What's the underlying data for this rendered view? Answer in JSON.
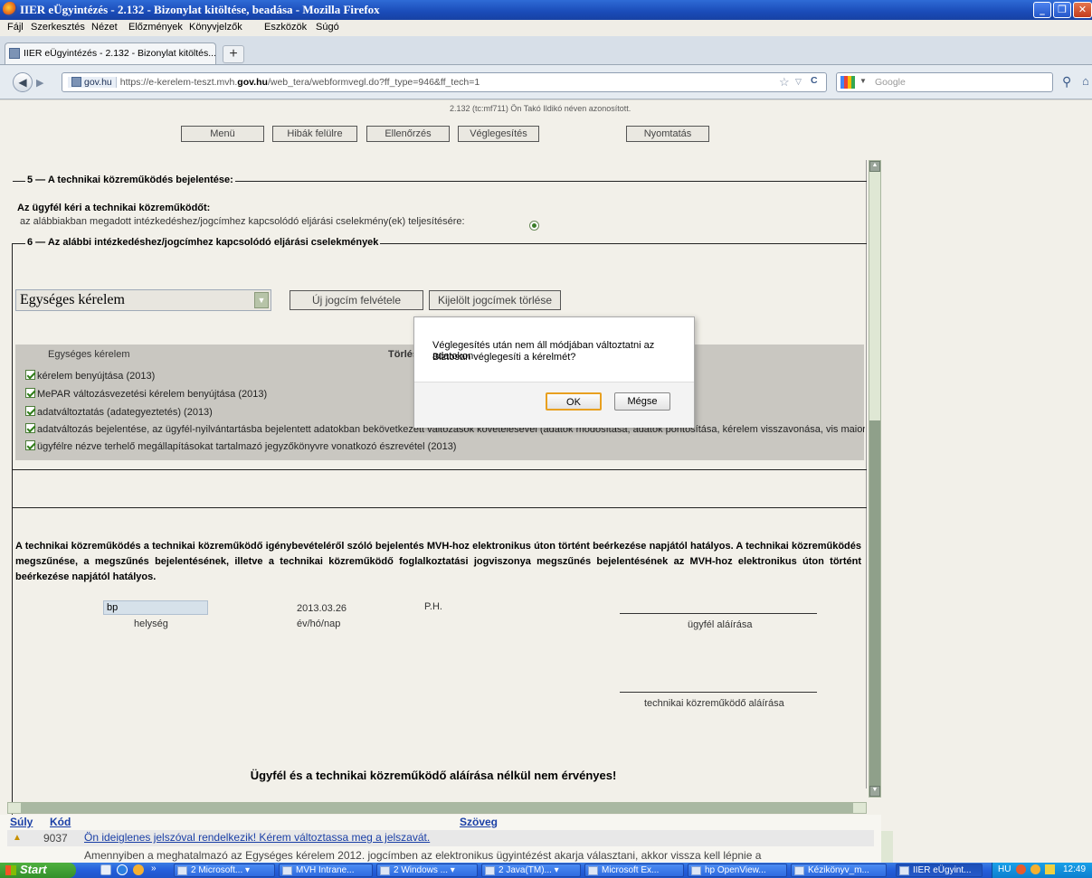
{
  "window": {
    "title": "IIER eÜgyintézés - 2.132 - Bizonylat kitöltése, beadása - Mozilla Firefox",
    "minimize": "_",
    "restore": "❐",
    "close": "✕"
  },
  "menu": [
    "Fájl",
    "Szerkesztés",
    "Nézet",
    "Előzmények",
    "Könyvjelzők",
    "Eszközök",
    "Súgó"
  ],
  "tab": {
    "label": "IIER eÜgyintézés - 2.132 - Bizonylat kitöltés...",
    "new": "+"
  },
  "nav": {
    "site": "gov.hu",
    "url_prefix": "https://e-kerelem-teszt.mvh.",
    "url_domain": "gov.hu",
    "url_suffix": "/web_tera/webformvegl.do?ff_type=946&ff_tech=1",
    "search_placeholder": "Google",
    "star": "☆",
    "dropdown": "▽",
    "reload": "C"
  },
  "page": {
    "user_info": "2.132 (tc:mf711) Ön Takó Ildikó néven azonosított.",
    "buttons": {
      "menu": "Menü",
      "errors": "Hibák felülre",
      "check": "Ellenőrzés",
      "finalize": "Véglegesítés",
      "print": "Nyomtatás"
    },
    "section5": {
      "title": "5 — A technikai közreműködés bejelentése:",
      "label": "Az ügyfél kéri a technikai közreműködőt:",
      "option": "az alábbiakban megadott intézkedéshez/jogcímhez kapcsolódó eljárási cselekmény(ek) teljesítésére:"
    },
    "section6": {
      "title": "6 — Az alábbi intézkedéshez/jogcímhez kapcsolódó eljárási cselekmények"
    },
    "select_value": "Egységes kérelem",
    "add_button": "Új jogcím felvétele",
    "delete_button": "Kijelölt jogcímek törlése",
    "table": {
      "header_title": "Egységes kérelem",
      "header_delete": "Törlés",
      "rows": [
        "kérelem benyújtása (2013)",
        "MePAR változásvezetési kérelem benyújtása (2013)",
        "adatváltoztatás (adategyeztetés) (2013)",
        "adatváltozás bejelentése, az ügyfél-nyilvántartásba bejelentett adatokban bekövetkezett változások követelésével (adatok módosítása, adatok pontosítása, kérelem visszavonása, vis maior",
        "ügyfélre nézve terhelő megállapításokat tartalmazó jegyzőkönyvre vonatkozó észrevétel (2013)"
      ]
    },
    "legal_text": "A technikai közreműködés a technikai közreműködő igénybevételéről szóló bejelentés MVH-hoz elektronikus úton történt beérkezése napjától hatályos. A technikai közreműködés megszűnése, a megszűnés bejelentésének, illetve a technikai közreműködő foglalkoztatási jogviszonya megszűnés bejelentésének az MVH-hoz elektronikus úton történt beérkezése napjától hatályos.",
    "place_value": "bp",
    "place_label": "helység",
    "date_value": "2013.03.26",
    "date_label": "év/hó/nap",
    "ph": "P.H.",
    "client_sign": "ügyfél aláírása",
    "tech_sign": "technikai közreműködő aláírása",
    "footer_note": "Ügyfél és a technikai közreműködő aláírása nélkül nem érvényes!"
  },
  "dialog": {
    "line1": "Véglegesítés után nem áll módjában változtatni az adatokon",
    "line2": "Biztosan véglegesíti a kérelmét?",
    "ok": "OK",
    "cancel": "Mégse"
  },
  "messages": {
    "col_weight": "Súly",
    "col_code": "Kód",
    "col_text": "Szöveg",
    "rows": [
      {
        "code": "9037",
        "text": "Ön ideiglenes jelszóval rendelkezik! Kérem változtassa meg a jelszavát."
      },
      {
        "code": "",
        "text": "Amennyiben a meghatalmazó az Egységes kérelem 2012. jogcímben az elektronikus ügyintézést akarja választani, akkor vissza kell lépnie a"
      }
    ]
  },
  "taskbar": {
    "start": "Start",
    "items": [
      "2 Microsoft...",
      "MVH Intrane...",
      "2 Windows ...",
      "2 Java(TM)...",
      "Microsoft Ex...",
      "hp OpenView...",
      "Kézikönyv_m...",
      "IIER eÜgyint..."
    ],
    "lang": "HU",
    "time": "12:49"
  },
  "colors": {
    "title_blue": "#245edb",
    "ok_border": "#e8a020",
    "taskbar_green": "#3c9a32"
  }
}
